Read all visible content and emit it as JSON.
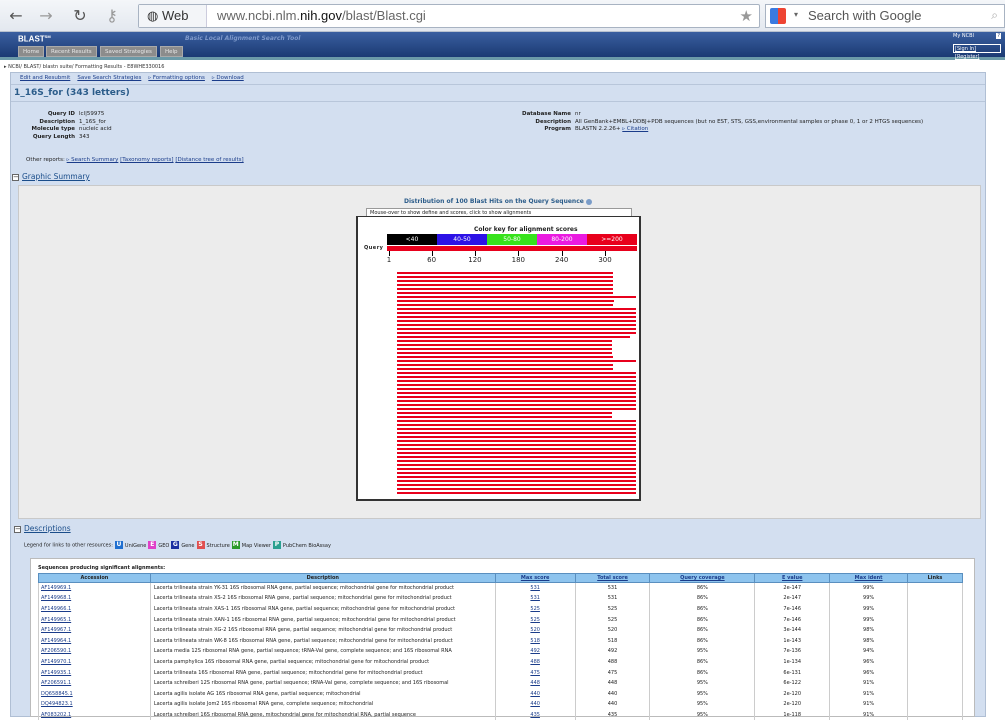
{
  "browser": {
    "back": "←",
    "forward": "→",
    "reload": "↻",
    "key": "⚷",
    "web_label": "Web",
    "url_pre": "www.ncbi.nlm.",
    "url_bold": "nih.gov",
    "url_post": "/blast/Blast.cgi",
    "search_placeholder": "Search with Google"
  },
  "header": {
    "logo": "BLAST",
    "tagline": "Basic Local Alignment Search Tool",
    "tabs": [
      "Home",
      "Recent Results",
      "Saved Strategies",
      "Help"
    ],
    "myncbi": "My NCBI",
    "myncbi_help": "?",
    "signin": "[Sign In] [Register]"
  },
  "breadcrumb": "▸ NCBI/ BLAST/ blastn suite/ Formatting Results - E8WHE330016",
  "actions": [
    "Edit and Resubmit",
    "Save Search Strategies",
    "▹ Formatting options",
    "▹ Download"
  ],
  "query": {
    "title": "1_16S_for (343 letters)",
    "fields": [
      {
        "label": "Query ID",
        "value": "lcl|59975"
      },
      {
        "label": "Description",
        "value": "1_16S_for"
      },
      {
        "label": "Molecule type",
        "value": "nucleic acid"
      },
      {
        "label": "Query Length",
        "value": "343"
      }
    ],
    "db_fields": [
      {
        "label": "Database Name",
        "value": "nr"
      },
      {
        "label": "Description",
        "value": "All GenBank+EMBL+DDBJ+PDB sequences (but no EST, STS, GSS,environmental samples or phase 0, 1 or 2 HTGS sequences)"
      },
      {
        "label": "Program",
        "value": "BLASTN 2.2.26+"
      }
    ],
    "citation": "▹ Citation"
  },
  "other_reports": {
    "label": "Other reports:",
    "links": [
      "▹ Search Summary",
      "[Taxonomy reports]",
      "[Distance tree of results]"
    ]
  },
  "graphic": {
    "section": "Graphic Summary",
    "title": "Distribution of 100 Blast Hits on the Query Sequence",
    "mouseover": "Mouse-over to show define and scores, click to show alignments",
    "color_key_title": "Color key for alignment scores",
    "color_key": [
      {
        "label": "<40",
        "color": "#000000"
      },
      {
        "label": "40-50",
        "color": "#2c12e6"
      },
      {
        "label": "50-80",
        "color": "#37e21c"
      },
      {
        "label": "80-200",
        "color": "#ea1be0"
      },
      {
        "label": ">=200",
        "color": "#e8001c"
      }
    ],
    "query_label": "Query",
    "ticks": [
      "1",
      "60",
      "120",
      "180",
      "240",
      "300"
    ],
    "query_length": 343,
    "hits": [
      [
        12,
        311
      ],
      [
        12,
        311
      ],
      [
        12,
        311
      ],
      [
        12,
        311
      ],
      [
        12,
        311
      ],
      [
        12,
        311
      ],
      [
        12,
        343
      ],
      [
        12,
        312
      ],
      [
        12,
        311
      ],
      [
        12,
        343
      ],
      [
        12,
        343
      ],
      [
        12,
        343
      ],
      [
        12,
        343
      ],
      [
        12,
        343
      ],
      [
        12,
        343
      ],
      [
        12,
        343
      ],
      [
        12,
        334
      ],
      [
        12,
        310
      ],
      [
        12,
        310
      ],
      [
        12,
        310
      ],
      [
        12,
        310
      ],
      [
        12,
        311
      ],
      [
        12,
        343
      ],
      [
        12,
        311
      ],
      [
        12,
        311
      ],
      [
        12,
        343
      ],
      [
        12,
        343
      ],
      [
        12,
        343
      ],
      [
        12,
        343
      ],
      [
        12,
        343
      ],
      [
        12,
        343
      ],
      [
        12,
        343
      ],
      [
        12,
        343
      ],
      [
        12,
        343
      ],
      [
        12,
        343
      ],
      [
        12,
        310
      ],
      [
        12,
        310
      ],
      [
        12,
        343
      ],
      [
        12,
        343
      ],
      [
        12,
        343
      ],
      [
        12,
        343
      ],
      [
        12,
        343
      ],
      [
        12,
        343
      ],
      [
        12,
        343
      ],
      [
        12,
        343
      ],
      [
        12,
        343
      ],
      [
        12,
        343
      ],
      [
        12,
        343
      ],
      [
        12,
        343
      ],
      [
        12,
        343
      ],
      [
        12,
        343
      ],
      [
        12,
        343
      ],
      [
        12,
        343
      ],
      [
        12,
        343
      ],
      [
        12,
        343
      ],
      [
        12,
        343
      ]
    ]
  },
  "descriptions": {
    "section": "Descriptions",
    "legend_label": "Legend for links to other resources:",
    "legend": [
      {
        "icon": "U",
        "label": "UniGene",
        "color": "#1f6fd0"
      },
      {
        "icon": "E",
        "label": "GEO",
        "color": "#e040c8"
      },
      {
        "icon": "G",
        "label": "Gene",
        "color": "#1a2fa0"
      },
      {
        "icon": "S",
        "label": "Structure",
        "color": "#e05050"
      },
      {
        "icon": "M",
        "label": "Map Viewer",
        "color": "#2a9a2a"
      },
      {
        "icon": "P",
        "label": "PubChem BioAssay",
        "color": "#2aa090"
      }
    ],
    "table_title": "Sequences producing significant alignments:",
    "columns": [
      "Accession",
      "Description",
      "Max score",
      "Total score",
      "Query coverage",
      "E value",
      "Max ident",
      "Links"
    ],
    "rows": [
      [
        "AF149969.1",
        "Lacerta trilineata strain YK-31 16S ribosomal RNA gene, partial sequence; mitochondrial gene for mitochondrial product",
        "531",
        "531",
        "86%",
        "2e-147",
        "99%"
      ],
      [
        "AF149968.1",
        "Lacerta trilineata strain XS-2 16S ribosomal RNA gene, partial sequence; mitochondrial gene for mitochondrial product",
        "531",
        "531",
        "86%",
        "2e-147",
        "99%"
      ],
      [
        "AF149966.1",
        "Lacerta trilineata strain XAS-1 16S ribosomal RNA gene, partial sequence; mitochondrial gene for mitochondrial product",
        "525",
        "525",
        "86%",
        "7e-146",
        "99%"
      ],
      [
        "AF149965.1",
        "Lacerta trilineata strain XAN-1 16S ribosomal RNA gene, partial sequence; mitochondrial gene for mitochondrial product",
        "525",
        "525",
        "86%",
        "7e-146",
        "99%"
      ],
      [
        "AF149967.1",
        "Lacerta trilineata strain XG-2 16S ribosomal RNA gene, partial sequence; mitochondrial gene for mitochondrial product",
        "520",
        "520",
        "86%",
        "3e-144",
        "98%"
      ],
      [
        "AF149964.1",
        "Lacerta trilineata strain WK-8 16S ribosomal RNA gene, partial sequence; mitochondrial gene for mitochondrial product",
        "518",
        "518",
        "86%",
        "1e-143",
        "98%"
      ],
      [
        "AF206590.1",
        "Lacerta media 12S ribosomal RNA gene, partial sequence; tRNA-Val gene, complete sequence; and 16S ribosomal RNA",
        "492",
        "492",
        "95%",
        "7e-136",
        "94%"
      ],
      [
        "AF149970.1",
        "Lacerta pamphylica 16S ribosomal RNA gene, partial sequence; mitochondrial gene for mitochondrial product",
        "488",
        "488",
        "86%",
        "1e-134",
        "96%"
      ],
      [
        "AF149935.1",
        "Lacerta trilineata 16S ribosomal RNA gene, partial sequence; mitochondrial gene for mitochondrial product",
        "475",
        "475",
        "86%",
        "6e-131",
        "96%"
      ],
      [
        "AF206591.1",
        "Lacerta schreiberi 12S ribosomal RNA gene, partial sequence; tRNA-Val gene, complete sequence; and 16S ribosomal",
        "448",
        "448",
        "95%",
        "6e-122",
        "91%"
      ],
      [
        "DQ658845.1",
        "Lacerta agilis isolate AG 16S ribosomal RNA gene, partial sequence; mitochondrial",
        "440",
        "440",
        "95%",
        "2e-120",
        "91%"
      ],
      [
        "DQ494823.1",
        "Lacerta agilis isolate Jom2 16S ribosomal RNA gene, complete sequence; mitochondrial",
        "440",
        "440",
        "95%",
        "2e-120",
        "91%"
      ],
      [
        "AF083202.1",
        "Lacerta schreiberi 16S ribosomal RNA gene, mitochondrial gene for mitochondrial RNA, partial sequence",
        "435",
        "435",
        "95%",
        "1e-118",
        "91%"
      ]
    ]
  }
}
